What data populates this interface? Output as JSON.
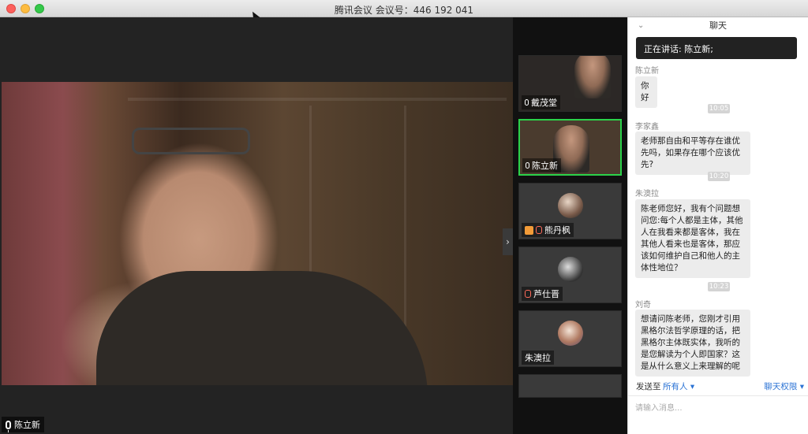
{
  "window": {
    "title": "腾讯会议 会议号：446 192 041"
  },
  "main_video": {
    "speaker_name": "陈立新"
  },
  "participants": [
    {
      "name": "戴茂堂"
    },
    {
      "name": "陈立新"
    },
    {
      "name": "熊丹枫"
    },
    {
      "name": "芦仕晋"
    },
    {
      "name": "朱澳拉"
    }
  ],
  "chat": {
    "title": "聊天",
    "speaking_now": "正在讲话: 陈立新;",
    "messages": [
      {
        "sender": "陈立新",
        "text": "你好"
      },
      {
        "time": "10:05"
      },
      {
        "sender": "李家鑫",
        "text": "老师那自由和平等存在谁优先吗，如果存在哪个应该优先?"
      },
      {
        "time": "10:20"
      },
      {
        "sender": "朱澳拉",
        "text": "陈老师您好，我有个问题想问您:每个人都是主体，其他人在我看来都是客体，我在其他人看来也是客体，那应该如何维护自己和他人的主体性地位？"
      },
      {
        "time": "10:23"
      },
      {
        "sender": "刘奇",
        "text": "想请问陈老师，您刚才引用黑格尔法哲学原理的话，把黑格尔主体既实体，我听的是您解读为个人即国家？这是从什么意义上来理解的呢"
      }
    ],
    "send_to_label": "发送至",
    "recipient": "所有人",
    "permissions_label": "聊天权限",
    "input_placeholder": "请输入消息..."
  }
}
